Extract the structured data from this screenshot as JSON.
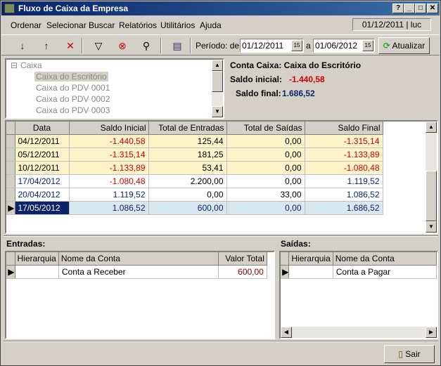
{
  "window": {
    "title": "Fluxo de Caixa da Empresa"
  },
  "menu": {
    "items": [
      "Ordenar",
      "Selecionar",
      "Buscar",
      "Relatórios",
      "Utilitários",
      "Ajuda"
    ],
    "status": "01/12/2011 | luc"
  },
  "toolbar": {
    "periodo_label": "Período: de",
    "date_from": "01/12/2011",
    "a_label": "a",
    "date_to": "01/06/2012",
    "atualizar_label": "Atualizar"
  },
  "tree": {
    "root": "Caixa",
    "children": [
      "Caixa do Escritório",
      "Caixa do PDV 0001",
      "Caixa do PDV 0002",
      "Caixa do PDV 0003"
    ]
  },
  "info": {
    "conta_caixa": "Conta Caixa: Caixa do Escritório",
    "saldo_inicial_label": "Saldo inicial:",
    "saldo_inicial_value": "-1.440,58",
    "saldo_final_label": "Saldo final:",
    "saldo_final_value": "1.686,52"
  },
  "main_grid": {
    "columns": [
      "Data",
      "Saldo Inicial",
      "Total de Entradas",
      "Total de Saídas",
      "Saldo Final"
    ],
    "rows": [
      {
        "data": "04/12/2011",
        "saldo_inicial": "-1.440,58",
        "entradas": "125,44",
        "saidas": "0,00",
        "saldo_final": "-1.315,14"
      },
      {
        "data": "05/12/2011",
        "saldo_inicial": "-1.315,14",
        "entradas": "181,25",
        "saidas": "0,00",
        "saldo_final": "-1.133,89"
      },
      {
        "data": "10/12/2011",
        "saldo_inicial": "-1.133,89",
        "entradas": "53,41",
        "saidas": "0,00",
        "saldo_final": "-1.080,48"
      },
      {
        "data": "17/04/2012",
        "saldo_inicial": "-1.080,48",
        "entradas": "2.200,00",
        "saidas": "0,00",
        "saldo_final": "1.119,52"
      },
      {
        "data": "20/04/2012",
        "saldo_inicial": "1.119,52",
        "entradas": "0,00",
        "saidas": "33,00",
        "saldo_final": "1.086,52"
      },
      {
        "data": "17/05/2012",
        "saldo_inicial": "1.086,52",
        "entradas": "600,00",
        "saidas": "0,00",
        "saldo_final": "1.686,52"
      }
    ]
  },
  "entradas": {
    "label": "Entradas:",
    "columns": [
      "Hierarquia",
      "Nome da Conta",
      "Valor Total"
    ],
    "rows": [
      {
        "hierarquia": "",
        "nome": "Conta a Receber",
        "valor": "600,00"
      }
    ]
  },
  "saidas": {
    "label": "Saídas:",
    "columns": [
      "Hierarquia",
      "Nome da Conta"
    ],
    "rows": [
      {
        "hierarquia": "",
        "nome": "Conta a Pagar"
      }
    ]
  },
  "footer": {
    "sair_label": "Sair"
  },
  "colors": {
    "title_start": "#0a246a",
    "title_end": "#3a6ea5",
    "row_yellow": "#fcf3c8",
    "row_selected": "#d7e8f0",
    "negative": "#d00000",
    "positive": "#0a246a"
  }
}
